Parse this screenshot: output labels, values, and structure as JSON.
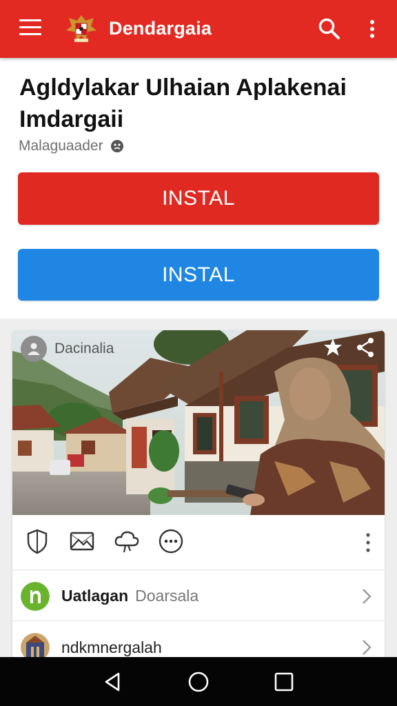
{
  "appbar": {
    "title": "Dendargaia",
    "icons": [
      "menu-icon",
      "emblem-logo",
      "search-icon",
      "more-vert-icon"
    ],
    "color": "#e32a22"
  },
  "app": {
    "title": "Agldylakar Ulhaian Aplakenai Imdargaii",
    "developer": "Malaguaader"
  },
  "buttons": {
    "primary_label": "INSTAL",
    "secondary_label": "INSTAL",
    "primary_color": "#e02a21",
    "secondary_color": "#1f86e3"
  },
  "post": {
    "author": "Dacinalia",
    "photo_icons": [
      "star-icon",
      "share-icon"
    ],
    "actions": [
      "shield-icon",
      "image-mail-icon",
      "cloud-share-icon",
      "chat-dots-icon",
      "overflow-icon"
    ]
  },
  "list": [
    {
      "bold": "Uatlagan",
      "grey": "Doarsala",
      "icon": "avatar-green"
    },
    {
      "text": "ndkmnergalah",
      "icon": "avatar-photo"
    }
  ],
  "navbar": {
    "icons": [
      "back-icon",
      "home-icon",
      "recents-icon"
    ]
  }
}
